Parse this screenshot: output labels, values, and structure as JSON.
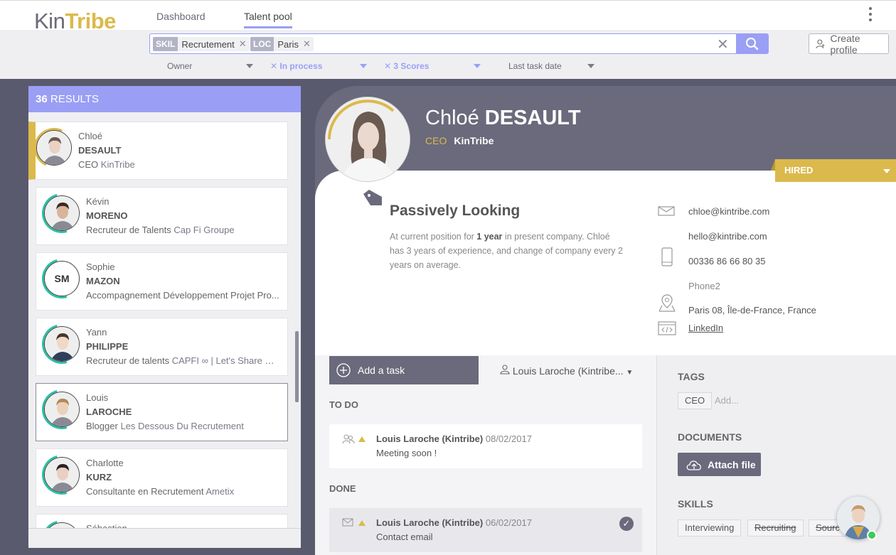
{
  "brand": {
    "kin": "Kin",
    "tribe": "Tribe"
  },
  "nav": [
    {
      "label": "Dashboard"
    },
    {
      "label": "Talent pool"
    }
  ],
  "search": {
    "chips": [
      {
        "key": "SKIL",
        "value": "Recrutement"
      },
      {
        "key": "LOC",
        "value": "Paris"
      }
    ],
    "create_label": "Create profile"
  },
  "filters": [
    {
      "label": "Owner",
      "active": false
    },
    {
      "label": "In process",
      "active": true
    },
    {
      "label": "3 Scores",
      "active": true
    },
    {
      "label": "Last task date",
      "active": false
    }
  ],
  "results": {
    "count": "36",
    "label": "RESULTS"
  },
  "candidates": [
    {
      "first": "Chloé",
      "last": "DESAULT",
      "position": "CEO",
      "company": "KinTribe",
      "initials": "",
      "score": 0.25
    },
    {
      "first": "Kévin",
      "last": "MORENO",
      "position": "Recruteur de Talents",
      "company": "Cap Fi Groupe",
      "initials": "",
      "score": 0.6
    },
    {
      "first": "Sophie",
      "last": "MAZON",
      "position": "Accompagnement Développement Projet Pro...",
      "company": "",
      "initials": "SM",
      "score": 0.6
    },
    {
      "first": "Yann",
      "last": "PHILIPPE",
      "position": "Recruteur de talents",
      "company": "CAPFI ∞ | Let's Share Mo...",
      "initials": "",
      "score": 0.6
    },
    {
      "first": "Louis",
      "last": "LAROCHE",
      "position": "Blogger",
      "company": "Les Dessous Du Recrutement",
      "initials": "",
      "score": 0.6
    },
    {
      "first": "Charlotte",
      "last": "KURZ",
      "position": "Consultante en Recrutement",
      "company": "Ametix",
      "initials": "",
      "score": 0.6
    },
    {
      "first": "Sébastien",
      "last": "",
      "position": "",
      "company": "",
      "initials": "",
      "score": 0.6
    }
  ],
  "profile": {
    "first": "Chloé",
    "last": "DESAULT",
    "role": "CEO",
    "company": "KinTribe",
    "stage": "HIRED",
    "status_title": "Passively Looking",
    "desc_pre": "At current position for ",
    "desc_bold": "1 year",
    "desc_post": " in present company. Chloé has 3 years of experience, and change of company every 2 years on average.",
    "email1": "chloe@kintribe.com",
    "email2": "hello@kintribe.com",
    "phone": "00336 86 66 80 35",
    "phone2": "Phone2",
    "location": "Paris 08, Île-de-France, France",
    "linkedin": "LinkedIn"
  },
  "tasks": {
    "add_label": "Add a task",
    "owner": "Louis Laroche (Kintribe...",
    "todo_label": "TO DO",
    "done_label": "DONE",
    "todo": [
      {
        "who": "Louis Laroche (Kintribe)",
        "date": "08/02/2017",
        "text": "Meeting soon !"
      }
    ],
    "done": [
      {
        "who": "Louis Laroche (Kintribe)",
        "date": "06/02/2017",
        "text": "Contact email"
      }
    ]
  },
  "side": {
    "tags_label": "TAGS",
    "tags": [
      "CEO"
    ],
    "add_placeholder": "Add...",
    "documents_label": "DOCUMENTS",
    "attach_label": "Attach file",
    "skills_label": "SKILLS",
    "skills": [
      {
        "label": "Interviewing",
        "strike": false
      },
      {
        "label": "Recruiting",
        "strike": true
      },
      {
        "label": "Sourc",
        "strike": true
      }
    ]
  },
  "colors": {
    "accent": "#9a9ff5",
    "gold": "#dcb94c",
    "dark": "#6a6a7c",
    "teal": "#2ebfa5"
  }
}
